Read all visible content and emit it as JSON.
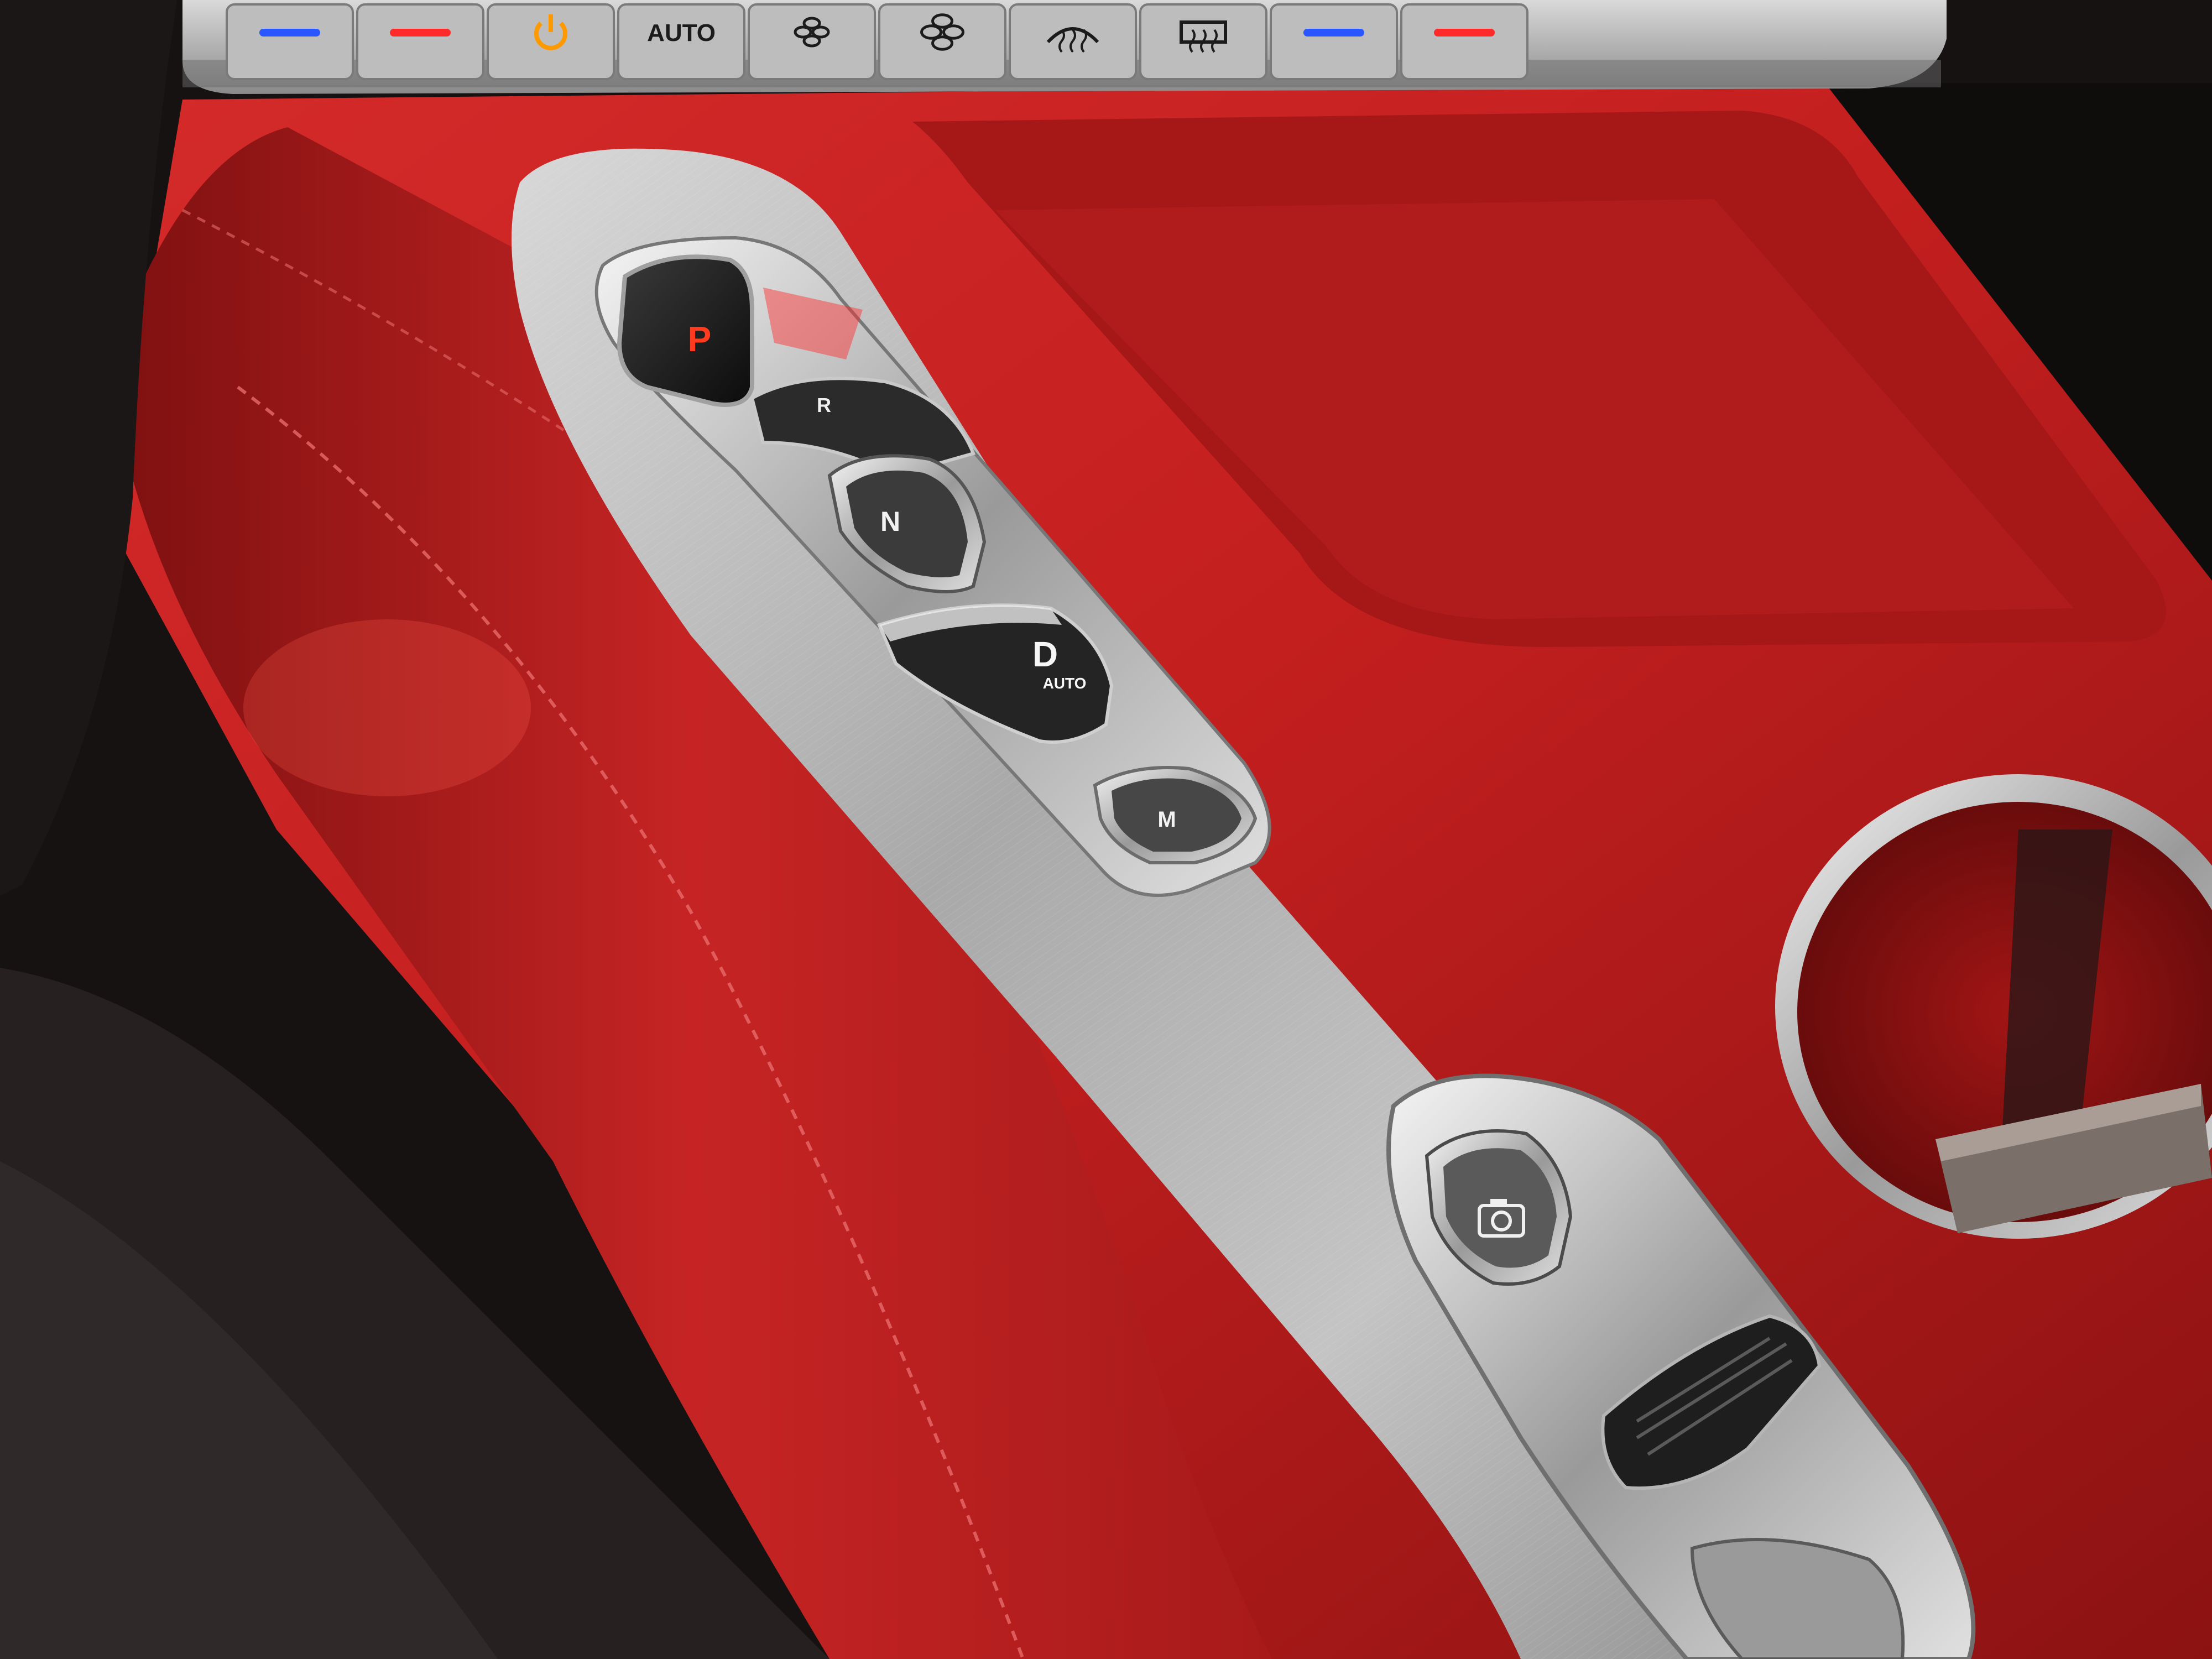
{
  "colors": {
    "leather": "#c41f1f",
    "leather_dark": "#7e1010",
    "leather_light": "#e04a4a",
    "brushed_metal": "#b9b9b9",
    "chrome": "#e4e4e4",
    "black_trim": "#141111",
    "park_indicator": "#ff3b1f",
    "blue_led": "#2a56ff",
    "red_led": "#ff2a2a",
    "power_orange": "#ff9900"
  },
  "climate_strip": {
    "buttons": [
      {
        "name": "temp-cool-left-button",
        "icon": "blue-led-icon",
        "label": ""
      },
      {
        "name": "temp-warm-left-button",
        "icon": "red-led-icon",
        "label": ""
      },
      {
        "name": "power-button",
        "icon": "power-icon",
        "label": ""
      },
      {
        "name": "auto-climate-button",
        "icon": "",
        "label": "AUTO"
      },
      {
        "name": "fan-down-button",
        "icon": "fan-small-icon",
        "label": ""
      },
      {
        "name": "fan-up-button",
        "icon": "fan-large-icon",
        "label": ""
      },
      {
        "name": "front-defrost-button",
        "icon": "front-defrost-icon",
        "label": ""
      },
      {
        "name": "rear-defrost-button",
        "icon": "rear-defrost-icon",
        "label": ""
      },
      {
        "name": "temp-cool-right-button",
        "icon": "blue-led-icon",
        "label": ""
      },
      {
        "name": "temp-warm-right-button",
        "icon": "red-led-icon",
        "label": ""
      }
    ]
  },
  "shifter": {
    "park_label": "P",
    "reverse_label": "R",
    "neutral_label": "N",
    "drive_label": "D",
    "drive_sublabel": "AUTO",
    "manual_label": "M",
    "selected": "P"
  },
  "lower_controls": {
    "camera_icon": "camera-icon",
    "drive_mode_icon": "drive-mode-roller-icon"
  }
}
